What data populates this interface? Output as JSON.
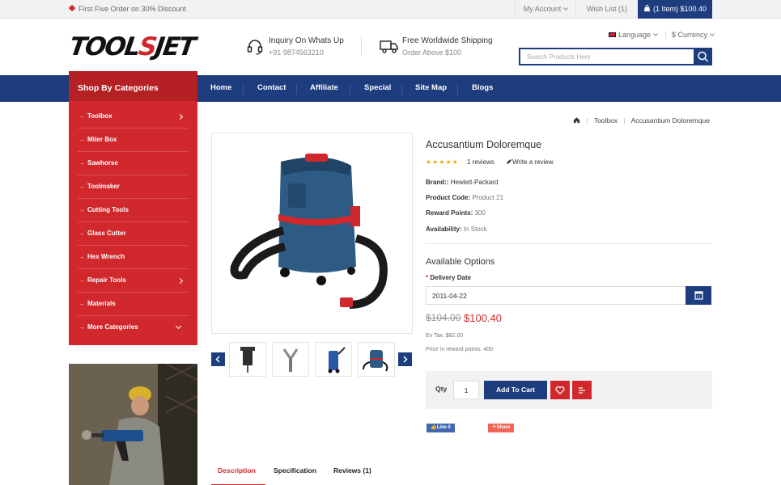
{
  "topbar": {
    "promo": "First Five Order on 30% Discount",
    "my_account": "My Account",
    "wish_list": "Wish List (1)",
    "cart": "(1 Item) $100.40"
  },
  "header": {
    "logo_part1": "TOOL",
    "logo_part2": "S",
    "logo_part3": "JET",
    "whatsapp_title": "Inquiry On Whats Up",
    "whatsapp_phone": "+91 9874563210",
    "shipping_title": "Free Worldwide Shipping",
    "shipping_sub": "Order Above $100",
    "language": "Language",
    "currency": "$ Currency",
    "search_placeholder": "Search Products Here"
  },
  "nav": {
    "items": [
      "Home",
      "Contact",
      "Affiliate",
      "Special",
      "Site Map",
      "Blogs"
    ]
  },
  "sidebar": {
    "heading": "Shop By Categories",
    "items": [
      {
        "label": "Toolbox",
        "arrow": "right"
      },
      {
        "label": "Miter Box",
        "arrow": ""
      },
      {
        "label": "Sawhorse",
        "arrow": ""
      },
      {
        "label": "Toolmaker",
        "arrow": ""
      },
      {
        "label": "Cutting Tools",
        "arrow": ""
      },
      {
        "label": "Glass Cutter",
        "arrow": ""
      },
      {
        "label": "Hex Wrench",
        "arrow": ""
      },
      {
        "label": "Repair Tools",
        "arrow": "right"
      },
      {
        "label": "Materials",
        "arrow": ""
      },
      {
        "label": "More Categories",
        "arrow": "down"
      }
    ]
  },
  "breadcrumb": {
    "items": [
      "Toolbox",
      "Accusantium Doloremque"
    ]
  },
  "product": {
    "title": "Accusantium Doloremque",
    "rating": 5,
    "stars": "★★★★★",
    "reviews": "1 reviews",
    "write_review": "Write a review",
    "brand_label": "Brand::",
    "brand_value": "Hewlett-Packard",
    "code_label": "Product Code:",
    "code_value": "Product 21",
    "reward_label": "Reward Points:",
    "reward_value": "300",
    "availability_label": "Availability:",
    "availability_value": "In Stock",
    "options_heading": "Available Options",
    "delivery_label": "Delivery Date",
    "delivery_required": "*",
    "delivery_value": "2011-04-22",
    "old_price": "$104.00",
    "new_price": "$100.40",
    "ex_tax": "Ex Tax: $82.00",
    "reward_price": "Price in reward points: 400",
    "qty_label": "Qty",
    "qty_value": "1",
    "add_to_cart": "Add To Cart",
    "like": "Like 0",
    "share": "Share"
  },
  "tabs": [
    "Description",
    "Specification",
    "Reviews (1)"
  ],
  "colors": {
    "navy": "#1d3d7e",
    "red": "#d0282c"
  }
}
